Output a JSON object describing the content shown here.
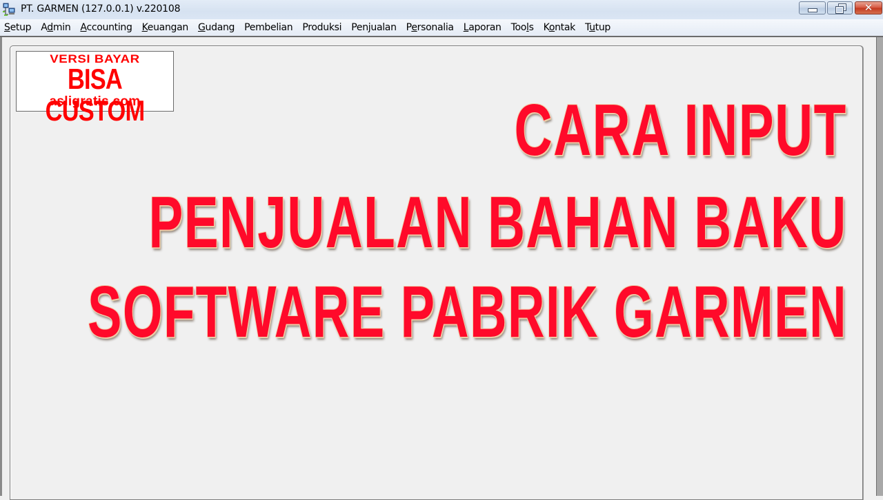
{
  "window": {
    "title": "PT. GARMEN (127.0.0.1) v.220108",
    "icon": "network-computer-icon",
    "controls": {
      "minimize": "minimize-icon",
      "restore": "restore-icon",
      "close": "close-icon"
    }
  },
  "menubar": {
    "items": [
      {
        "pre": "",
        "key": "S",
        "post": "etup"
      },
      {
        "pre": "A",
        "key": "d",
        "post": "min"
      },
      {
        "pre": "",
        "key": "A",
        "post": "ccounting"
      },
      {
        "pre": "",
        "key": "K",
        "post": "euangan"
      },
      {
        "pre": "",
        "key": "G",
        "post": "udang"
      },
      {
        "pre": "Pembelian",
        "key": "",
        "post": ""
      },
      {
        "pre": "Produksi",
        "key": "",
        "post": ""
      },
      {
        "pre": "Penjualan",
        "key": "",
        "post": ""
      },
      {
        "pre": "P",
        "key": "e",
        "post": "rsonalia"
      },
      {
        "pre": "",
        "key": "L",
        "post": "aporan"
      },
      {
        "pre": "Too",
        "key": "l",
        "post": "s"
      },
      {
        "pre": "K",
        "key": "o",
        "post": "ntak"
      },
      {
        "pre": "T",
        "key": "u",
        "post": "tup"
      }
    ]
  },
  "badge": {
    "line1": "VERSI BAYAR",
    "line2": "BISA CUSTOM",
    "line3": "asligratis.com",
    "color": "#ff0000"
  },
  "headline": {
    "line1": "CARA INPUT",
    "line2": "PENJUALAN BAHAN BAKU",
    "line3": "SOFTWARE PABRIK GARMEN",
    "color": "#ff0a2a"
  }
}
